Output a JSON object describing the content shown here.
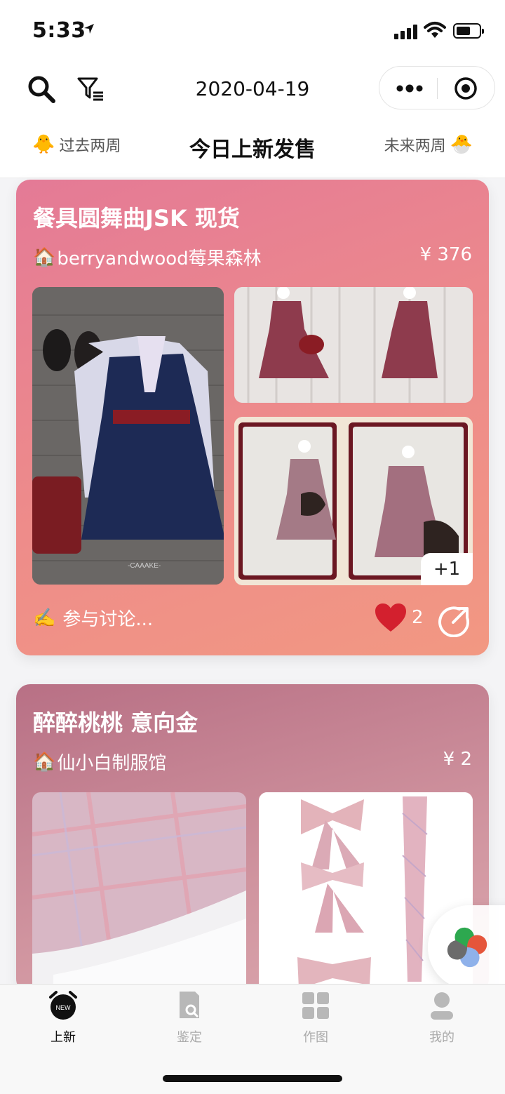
{
  "status_bar": {
    "time": "5:33"
  },
  "header": {
    "date": "2020-04-19"
  },
  "nav": {
    "past_label": "过去两周",
    "today_label": "今日上新发售",
    "future_label": "未来两周"
  },
  "cards": [
    {
      "title": "餐具圆舞曲JSK 现货",
      "shop": "berryandwood莓果森林",
      "price": "¥ 376",
      "more_photos": "+1",
      "discuss": "参与讨论...",
      "likes": "2"
    },
    {
      "title": "醉醉桃桃 意向金",
      "shop": "仙小白制服馆",
      "price": "¥ 2"
    }
  ],
  "tabs": [
    {
      "label": "上新",
      "badge": "NEW"
    },
    {
      "label": "鉴定"
    },
    {
      "label": "作图"
    },
    {
      "label": "我的"
    }
  ]
}
